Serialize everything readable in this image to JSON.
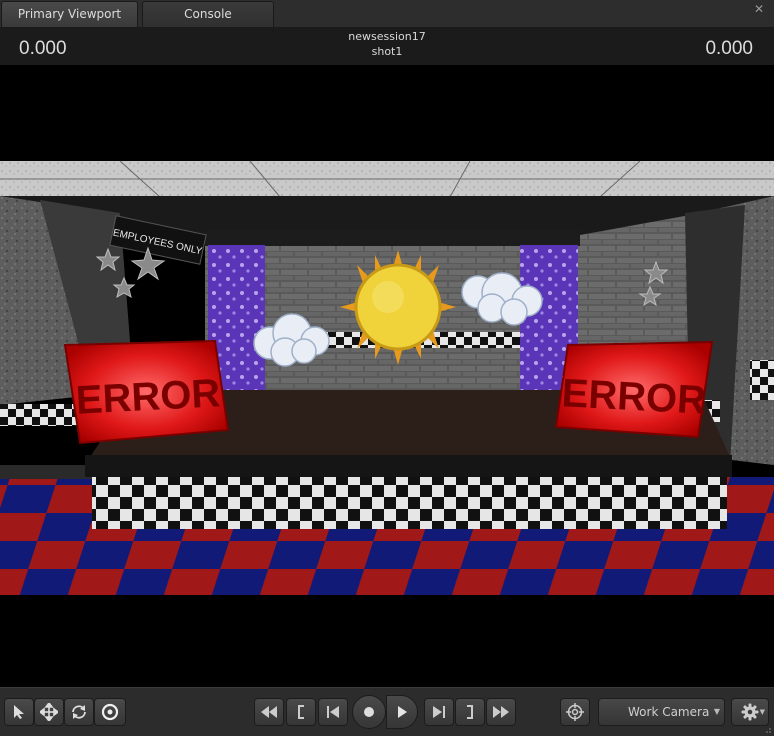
{
  "tabs": [
    {
      "label": "Primary Viewport",
      "active": true
    },
    {
      "label": "Console",
      "active": false
    }
  ],
  "close_glyph": "✕",
  "header": {
    "left_time": "0.000",
    "right_time": "0.000",
    "session": "newsession17",
    "shot": "shot1"
  },
  "scene": {
    "sign_text": "EMPLOYEES ONLY",
    "left_prop_text": "ERROR",
    "right_prop_text": "ERROR",
    "colors": {
      "curtain_purple": "#5b35b8",
      "sun_yellow": "#f0d23a",
      "floor_red": "#a01818",
      "floor_blue": "#121a78",
      "error_red": "#e01818"
    }
  },
  "toolbar": {
    "tools": [
      "select-arrow-icon",
      "move-icon",
      "rotate-icon",
      "scale-target-icon"
    ],
    "transport": [
      "rewind-icon",
      "mark-in-icon",
      "step-back-icon",
      "record-icon",
      "play-icon",
      "step-forward-icon",
      "mark-out-icon",
      "fast-forward-icon"
    ],
    "camera_label": "Work Camera",
    "camera_icon": "target-icon",
    "settings_icon": "gear-icon"
  }
}
